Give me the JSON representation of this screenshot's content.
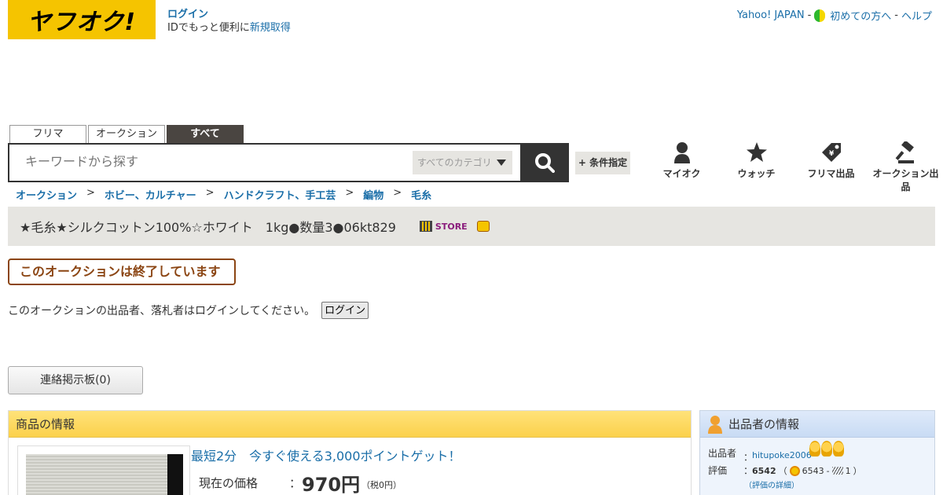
{
  "header": {
    "logo_text": "ヤフオク!",
    "login_label": "ログイン",
    "signup_prefix": "IDでもっと便利に",
    "signup_link": "新規取得",
    "links": [
      "Yahoo! JAPAN",
      "初めての方へ",
      "ヘルプ"
    ],
    "separator": "-"
  },
  "search": {
    "tabs": [
      "フリマ",
      "オークション",
      "すべて"
    ],
    "active_tab": "すべて",
    "placeholder": "キーワードから探す",
    "category": "すべてのカテゴリ",
    "condition_button": "+ 条件指定"
  },
  "nav": {
    "items": [
      {
        "label": "マイオク",
        "icon": "person-icon"
      },
      {
        "label": "ウォッチ",
        "icon": "star-icon"
      },
      {
        "label": "フリマ出品",
        "icon": "tag-icon"
      },
      {
        "label": "オークション出品",
        "icon": "gavel-icon"
      }
    ]
  },
  "breadcrumb": {
    "items": [
      "オークション",
      "ホビー、カルチャー",
      "ハンドクラフト、手工芸",
      "編物",
      "毛糸"
    ],
    "separator": ">"
  },
  "item": {
    "title": "★毛糸★シルクコットン100%☆ホワイト　1kg●数量3●06kt829",
    "store_badge": "STORE",
    "ended_notice": "このオークションは終了しています",
    "login_note": "このオークションの出品者、落札者はログインしてください。",
    "login_button": "ログイン",
    "board_button": "連絡掲示板(0)"
  },
  "product_info": {
    "heading": "商品の情報",
    "promo": "最短2分　今すぐ使える3,000ポイントゲット！",
    "price_label": "現在の価格",
    "colon": "：",
    "price": "970円",
    "tax": "（税0円）"
  },
  "seller_info": {
    "heading": "出品者の情報",
    "seller_label": "出品者",
    "rating_label": "評価",
    "colon": "：",
    "seller_name": "hitupoke2006",
    "rating_total": "6542",
    "positive": "6543",
    "negative": "1",
    "open_paren": "（",
    "dash": "-",
    "close_paren": "）",
    "detail_link": "（評価の詳細）"
  },
  "colors": {
    "brand_yellow": "#f5c400",
    "link_blue": "#1a6ea8",
    "ended_brown": "#8b4513"
  }
}
